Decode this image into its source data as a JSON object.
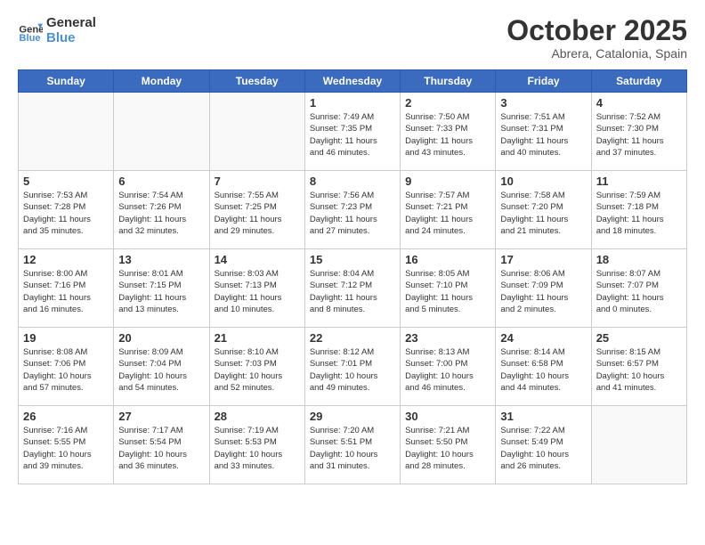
{
  "logo": {
    "line1": "General",
    "line2": "Blue"
  },
  "title": "October 2025",
  "location": "Abrera, Catalonia, Spain",
  "weekdays": [
    "Sunday",
    "Monday",
    "Tuesday",
    "Wednesday",
    "Thursday",
    "Friday",
    "Saturday"
  ],
  "weeks": [
    [
      {
        "day": "",
        "text": ""
      },
      {
        "day": "",
        "text": ""
      },
      {
        "day": "",
        "text": ""
      },
      {
        "day": "1",
        "text": "Sunrise: 7:49 AM\nSunset: 7:35 PM\nDaylight: 11 hours\nand 46 minutes."
      },
      {
        "day": "2",
        "text": "Sunrise: 7:50 AM\nSunset: 7:33 PM\nDaylight: 11 hours\nand 43 minutes."
      },
      {
        "day": "3",
        "text": "Sunrise: 7:51 AM\nSunset: 7:31 PM\nDaylight: 11 hours\nand 40 minutes."
      },
      {
        "day": "4",
        "text": "Sunrise: 7:52 AM\nSunset: 7:30 PM\nDaylight: 11 hours\nand 37 minutes."
      }
    ],
    [
      {
        "day": "5",
        "text": "Sunrise: 7:53 AM\nSunset: 7:28 PM\nDaylight: 11 hours\nand 35 minutes."
      },
      {
        "day": "6",
        "text": "Sunrise: 7:54 AM\nSunset: 7:26 PM\nDaylight: 11 hours\nand 32 minutes."
      },
      {
        "day": "7",
        "text": "Sunrise: 7:55 AM\nSunset: 7:25 PM\nDaylight: 11 hours\nand 29 minutes."
      },
      {
        "day": "8",
        "text": "Sunrise: 7:56 AM\nSunset: 7:23 PM\nDaylight: 11 hours\nand 27 minutes."
      },
      {
        "day": "9",
        "text": "Sunrise: 7:57 AM\nSunset: 7:21 PM\nDaylight: 11 hours\nand 24 minutes."
      },
      {
        "day": "10",
        "text": "Sunrise: 7:58 AM\nSunset: 7:20 PM\nDaylight: 11 hours\nand 21 minutes."
      },
      {
        "day": "11",
        "text": "Sunrise: 7:59 AM\nSunset: 7:18 PM\nDaylight: 11 hours\nand 18 minutes."
      }
    ],
    [
      {
        "day": "12",
        "text": "Sunrise: 8:00 AM\nSunset: 7:16 PM\nDaylight: 11 hours\nand 16 minutes."
      },
      {
        "day": "13",
        "text": "Sunrise: 8:01 AM\nSunset: 7:15 PM\nDaylight: 11 hours\nand 13 minutes."
      },
      {
        "day": "14",
        "text": "Sunrise: 8:03 AM\nSunset: 7:13 PM\nDaylight: 11 hours\nand 10 minutes."
      },
      {
        "day": "15",
        "text": "Sunrise: 8:04 AM\nSunset: 7:12 PM\nDaylight: 11 hours\nand 8 minutes."
      },
      {
        "day": "16",
        "text": "Sunrise: 8:05 AM\nSunset: 7:10 PM\nDaylight: 11 hours\nand 5 minutes."
      },
      {
        "day": "17",
        "text": "Sunrise: 8:06 AM\nSunset: 7:09 PM\nDaylight: 11 hours\nand 2 minutes."
      },
      {
        "day": "18",
        "text": "Sunrise: 8:07 AM\nSunset: 7:07 PM\nDaylight: 11 hours\nand 0 minutes."
      }
    ],
    [
      {
        "day": "19",
        "text": "Sunrise: 8:08 AM\nSunset: 7:06 PM\nDaylight: 10 hours\nand 57 minutes."
      },
      {
        "day": "20",
        "text": "Sunrise: 8:09 AM\nSunset: 7:04 PM\nDaylight: 10 hours\nand 54 minutes."
      },
      {
        "day": "21",
        "text": "Sunrise: 8:10 AM\nSunset: 7:03 PM\nDaylight: 10 hours\nand 52 minutes."
      },
      {
        "day": "22",
        "text": "Sunrise: 8:12 AM\nSunset: 7:01 PM\nDaylight: 10 hours\nand 49 minutes."
      },
      {
        "day": "23",
        "text": "Sunrise: 8:13 AM\nSunset: 7:00 PM\nDaylight: 10 hours\nand 46 minutes."
      },
      {
        "day": "24",
        "text": "Sunrise: 8:14 AM\nSunset: 6:58 PM\nDaylight: 10 hours\nand 44 minutes."
      },
      {
        "day": "25",
        "text": "Sunrise: 8:15 AM\nSunset: 6:57 PM\nDaylight: 10 hours\nand 41 minutes."
      }
    ],
    [
      {
        "day": "26",
        "text": "Sunrise: 7:16 AM\nSunset: 5:55 PM\nDaylight: 10 hours\nand 39 minutes."
      },
      {
        "day": "27",
        "text": "Sunrise: 7:17 AM\nSunset: 5:54 PM\nDaylight: 10 hours\nand 36 minutes."
      },
      {
        "day": "28",
        "text": "Sunrise: 7:19 AM\nSunset: 5:53 PM\nDaylight: 10 hours\nand 33 minutes."
      },
      {
        "day": "29",
        "text": "Sunrise: 7:20 AM\nSunset: 5:51 PM\nDaylight: 10 hours\nand 31 minutes."
      },
      {
        "day": "30",
        "text": "Sunrise: 7:21 AM\nSunset: 5:50 PM\nDaylight: 10 hours\nand 28 minutes."
      },
      {
        "day": "31",
        "text": "Sunrise: 7:22 AM\nSunset: 5:49 PM\nDaylight: 10 hours\nand 26 minutes."
      },
      {
        "day": "",
        "text": ""
      }
    ]
  ]
}
